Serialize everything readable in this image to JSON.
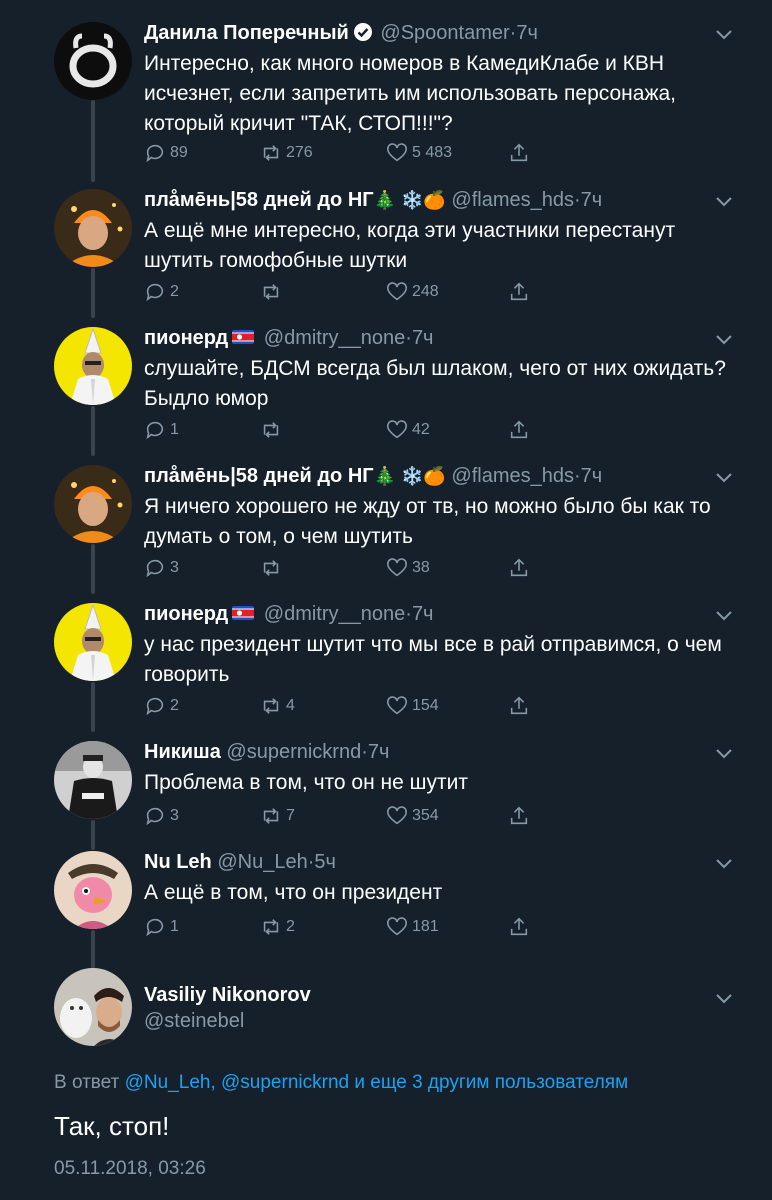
{
  "tweets": [
    {
      "name": "Данила Поперечный",
      "handle": "@Spoontamer",
      "time": "7ч",
      "text": "Интересно, как много номеров в КамедиКлабе и КВН исчезнет, если запретить им использовать персонажа, который кричит \"ТАК, СТОП!!!\"?",
      "replies": "89",
      "retweets": "276",
      "likes": "5 483"
    },
    {
      "name": "плåмēнь|58 дней до НГ",
      "name_emoji": "🎄 ❄️🍊",
      "handle": "@flames_hds",
      "time": "7ч",
      "text": "А ещё мне интересно, когда эти участники перестанут шутить гомофобные шутки",
      "replies": "2",
      "retweets": "",
      "likes": "248"
    },
    {
      "name": "пионерд",
      "handle": "@dmitry__none",
      "time": "7ч",
      "text": "слушайте, БДСМ всегда был шлаком, чего от них ожидать? Быдло юмор",
      "replies": "1",
      "retweets": "",
      "likes": "42"
    },
    {
      "name": "плåмēнь|58 дней до НГ",
      "name_emoji": "🎄 ❄️🍊",
      "handle": "@flames_hds",
      "time": "7ч",
      "text": "Я ничего хорошего не жду от тв, но можно было бы как то думать о том, о чем шутить",
      "replies": "3",
      "retweets": "",
      "likes": "38"
    },
    {
      "name": "пионерд",
      "handle": "@dmitry__none",
      "time": "7ч",
      "text": "у нас президент шутит что мы все в рай отправимся, о чем говорить",
      "replies": "2",
      "retweets": "4",
      "likes": "154"
    },
    {
      "name": "Никиша",
      "handle": "@supernickrnd",
      "time": "7ч",
      "text": "Проблема в том, что он не шутит",
      "replies": "3",
      "retweets": "7",
      "likes": "354"
    },
    {
      "name": "Nu Leh",
      "handle": "@Nu_Leh",
      "time": "5ч",
      "text": "А ещё в том, что он президент",
      "replies": "1",
      "retweets": "2",
      "likes": "181"
    }
  ],
  "main_tweet": {
    "name": "Vasiliy Nikonorov",
    "handle": "@steinebel",
    "reply_prefix": "В ответ",
    "reply_link": "@Nu_Leh, @supernickrnd и еще 3 другим пользователям",
    "text": "Так, стоп!",
    "timestamp": "05.11.2018, 03:26"
  },
  "separator": "·",
  "colors": {
    "background": "#15202b",
    "secondary_text": "#8899a6",
    "link": "#1da1f2",
    "thread_line": "#38444d"
  }
}
